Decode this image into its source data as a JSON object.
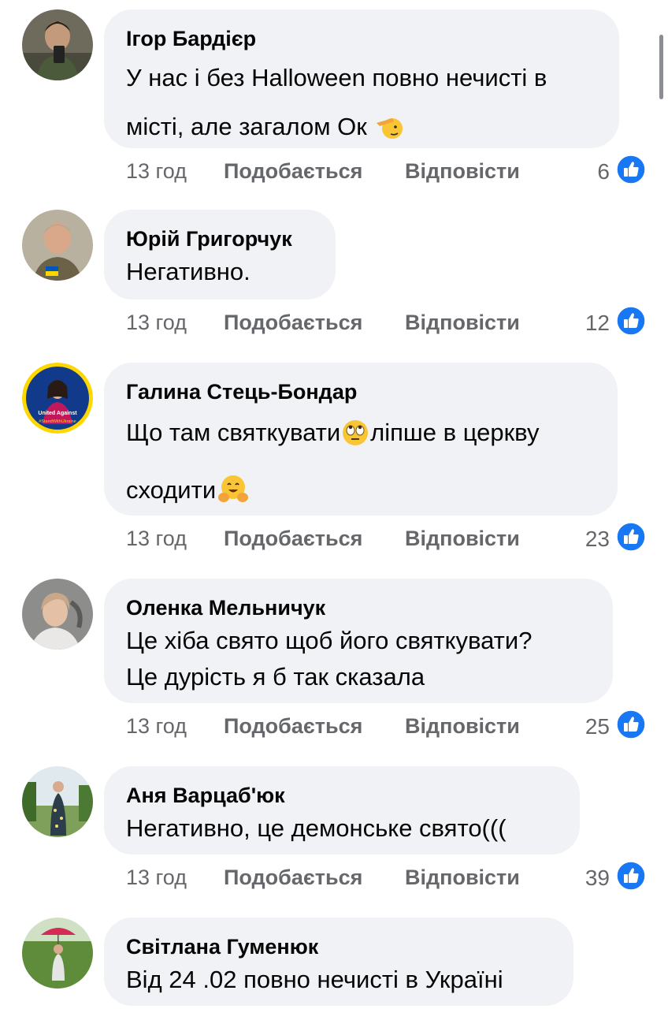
{
  "comments": [
    {
      "author": "Ігор Бардієр",
      "lines": [
        "У нас і без Halloween повно нечисті в",
        "місті, але загалом Ок"
      ],
      "emoji_after": "saluting-face",
      "time": "13 год",
      "like_label": "Подобається",
      "reply_label": "Відповісти",
      "likes": "6"
    },
    {
      "author": "Юрій Григорчук",
      "lines": [
        "Негативно."
      ],
      "time": "13 год",
      "like_label": "Подобається",
      "reply_label": "Відповісти",
      "likes": "12"
    },
    {
      "author": "Галина Стець-Бондар",
      "line1_a": "Що там святкувати",
      "line1_b": "ліпше в церкву",
      "line2": "сходити",
      "emoji_mid": "eye-roll-face",
      "emoji_end": "hugging-face",
      "avatar_badge": "#StandWithUkraine",
      "avatar_text": "United Against",
      "time": "13 год",
      "like_label": "Подобається",
      "reply_label": "Відповісти",
      "likes": "23"
    },
    {
      "author": "Оленка Мельничук",
      "lines": [
        "Це хіба  свято щоб його святкувати?",
        "Це дурість я б так сказала"
      ],
      "time": "13 год",
      "like_label": "Подобається",
      "reply_label": "Відповісти",
      "likes": "25"
    },
    {
      "author": "Аня Варцаб'юк",
      "lines": [
        "Негативно, це демонське свято((("
      ],
      "time": "13 год",
      "like_label": "Подобається",
      "reply_label": "Відповісти",
      "likes": "39"
    },
    {
      "author": "Світлана Гуменюк",
      "lines": [
        "Від 24 .02 повно нечисті в Україні"
      ]
    }
  ],
  "colors": {
    "bubble": "#f0f2f5",
    "meta_text": "#65676b",
    "like_blue": "#1877f2"
  },
  "icons": {
    "like": "thumbs-up-icon"
  }
}
